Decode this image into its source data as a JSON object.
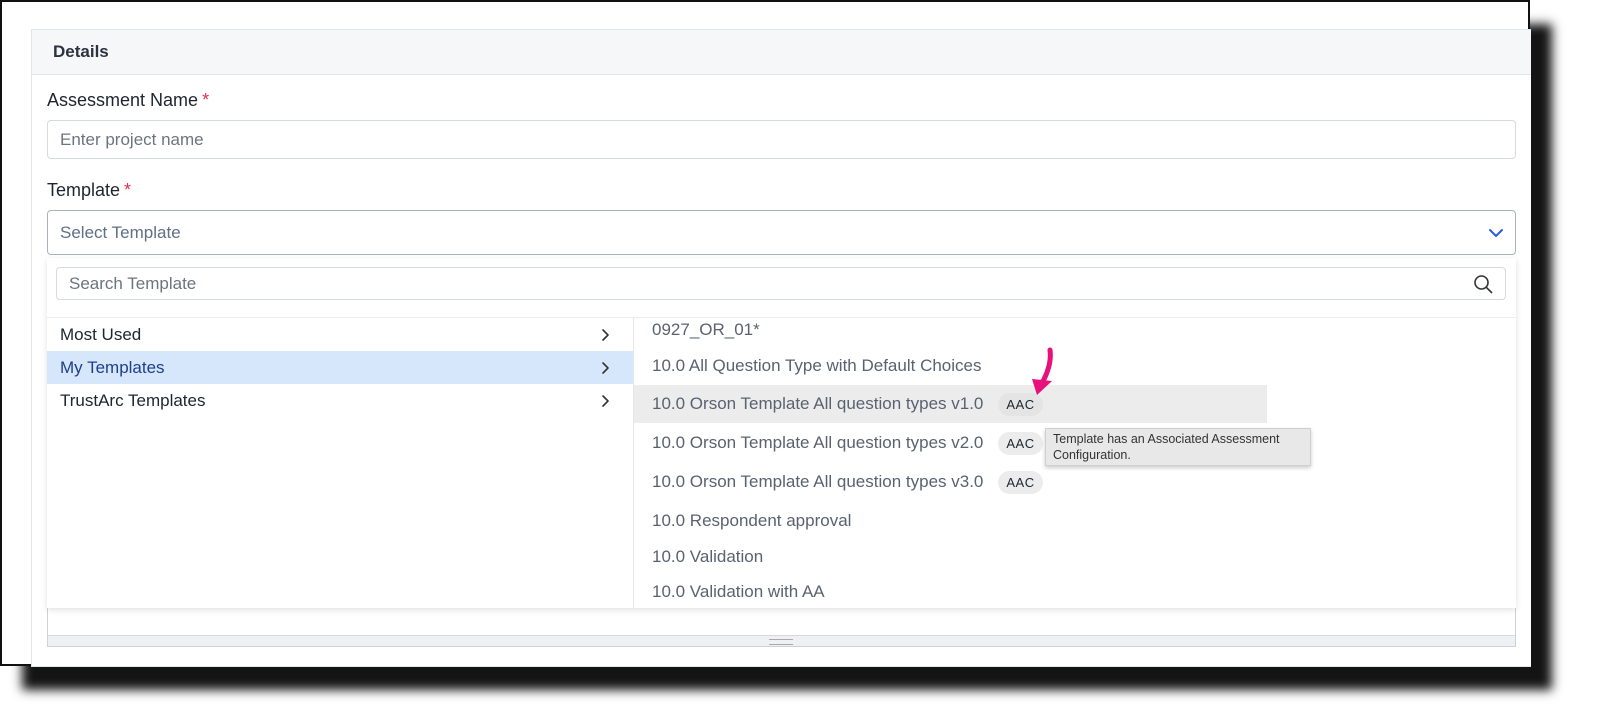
{
  "panel": {
    "title": "Details"
  },
  "assessment_name": {
    "label": "Assessment Name",
    "required_mark": "*",
    "placeholder": "Enter project name"
  },
  "template": {
    "label": "Template",
    "required_mark": "*",
    "placeholder": "Select Template"
  },
  "dropdown": {
    "search_placeholder": "Search Template",
    "categories": [
      {
        "label": "Most Used",
        "selected": false
      },
      {
        "label": "My Templates",
        "selected": true
      },
      {
        "label": "TrustArc Templates",
        "selected": false
      }
    ],
    "templates": [
      {
        "label": "0927_OR_01*",
        "badge": ""
      },
      {
        "label": "10.0 All Question Type with Default Choices",
        "badge": ""
      },
      {
        "label": "10.0 Orson Template All question types v1.0",
        "badge": "AAC",
        "hovered": true
      },
      {
        "label": "10.0 Orson Template All question types v2.0",
        "badge": "AAC"
      },
      {
        "label": "10.0 Orson Template All question types v3.0",
        "badge": "AAC"
      },
      {
        "label": "10.0 Respondent approval",
        "badge": ""
      },
      {
        "label": "10.0 Validation",
        "badge": ""
      },
      {
        "label": "10.0 Validation with AA",
        "badge": ""
      }
    ]
  },
  "tooltip": {
    "text": "Template has an Associated Assessment Configuration."
  },
  "colors": {
    "required": "#e0304a",
    "selected_bg": "#d6e6fb",
    "annotation_arrow": "#e8107a"
  },
  "icons": {
    "dropdown": "chevron-down-icon",
    "search": "search-icon",
    "category": "chevron-right-icon"
  }
}
